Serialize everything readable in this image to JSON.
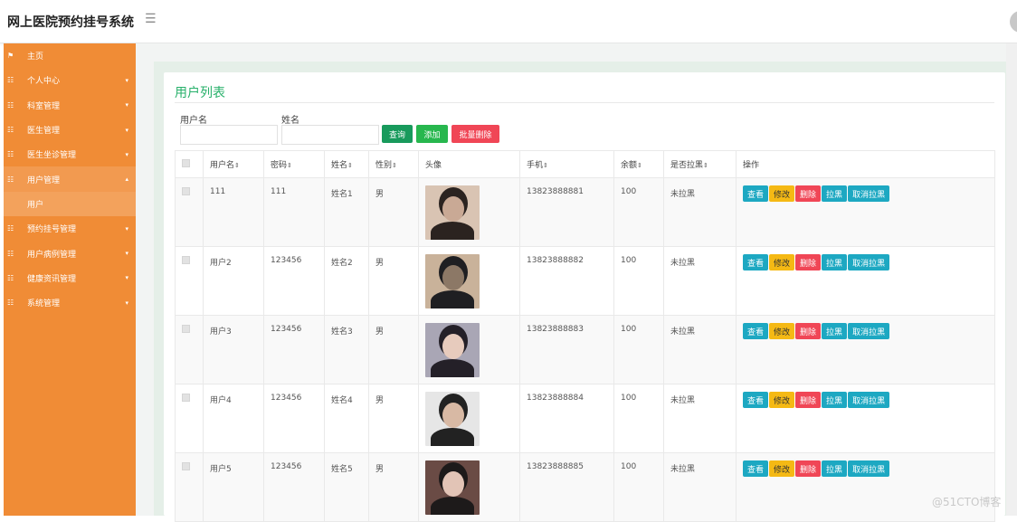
{
  "app": {
    "title": "网上医院预约挂号系统",
    "menu_icon": "hamburger-icon"
  },
  "sidebar": {
    "items": [
      {
        "label": "主页",
        "icon": "flag-icon",
        "has_caret": false
      },
      {
        "label": "个人中心",
        "icon": "grid-icon",
        "has_caret": true
      },
      {
        "label": "科室管理",
        "icon": "grid-icon",
        "has_caret": true
      },
      {
        "label": "医生管理",
        "icon": "grid-icon",
        "has_caret": true
      },
      {
        "label": "医生坐诊管理",
        "icon": "grid-icon",
        "has_caret": true
      },
      {
        "label": "用户管理",
        "icon": "grid-icon",
        "has_caret": true,
        "expanded": true
      },
      {
        "label": "用户",
        "icon": "",
        "has_caret": false,
        "sub": true
      },
      {
        "label": "预约挂号管理",
        "icon": "grid-icon",
        "has_caret": true
      },
      {
        "label": "用户病例管理",
        "icon": "grid-icon",
        "has_caret": true
      },
      {
        "label": "健康资讯管理",
        "icon": "grid-icon",
        "has_caret": true
      },
      {
        "label": "系统管理",
        "icon": "grid-icon",
        "has_caret": true
      }
    ]
  },
  "page": {
    "title": "用户列表",
    "search": {
      "username_label": "用户名",
      "username_value": "",
      "name_label": "姓名",
      "name_value": ""
    },
    "buttons": {
      "query": "查询",
      "add": "添加",
      "batch_delete": "批量删除"
    }
  },
  "table": {
    "columns": [
      "用户名",
      "密码",
      "姓名",
      "性别",
      "头像",
      "手机",
      "余额",
      "是否拉黑",
      "操作"
    ],
    "sort_indicator": "⇕",
    "row_actions": {
      "view": "查看",
      "edit": "修改",
      "delete": "删除",
      "blacklist": "拉黑",
      "unblacklist": "取消拉黑"
    },
    "rows": [
      {
        "username": "111",
        "password": "111",
        "name": "姓名1",
        "gender": "男",
        "phone": "13823888881",
        "balance": "100",
        "blacklisted": "未拉黑",
        "avatar_colors": [
          "#d9c4b3",
          "#2b2320",
          "#c9a995"
        ]
      },
      {
        "username": "用户2",
        "password": "123456",
        "name": "姓名2",
        "gender": "男",
        "phone": "13823888882",
        "balance": "100",
        "blacklisted": "未拉黑",
        "avatar_colors": [
          "#c9b29a",
          "#1f1f22",
          "#8c7866"
        ]
      },
      {
        "username": "用户3",
        "password": "123456",
        "name": "姓名3",
        "gender": "男",
        "phone": "13823888883",
        "balance": "100",
        "blacklisted": "未拉黑",
        "avatar_colors": [
          "#a9a6b5",
          "#242028",
          "#e7cbbd"
        ]
      },
      {
        "username": "用户4",
        "password": "123456",
        "name": "姓名4",
        "gender": "男",
        "phone": "13823888884",
        "balance": "100",
        "blacklisted": "未拉黑",
        "avatar_colors": [
          "#e6e6e6",
          "#222222",
          "#d8b9a4"
        ]
      },
      {
        "username": "用户5",
        "password": "123456",
        "name": "姓名5",
        "gender": "男",
        "phone": "13823888885",
        "balance": "100",
        "blacklisted": "未拉黑",
        "avatar_colors": [
          "#6a4b45",
          "#1d1a1a",
          "#e2c4b6"
        ]
      }
    ]
  },
  "watermark": "@51CTO博客"
}
